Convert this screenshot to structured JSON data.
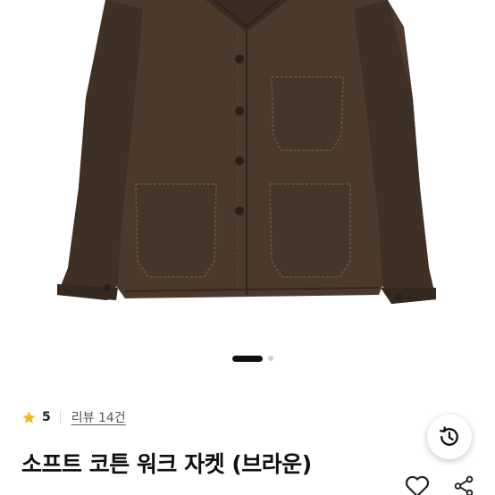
{
  "product": {
    "image_alt": "brown work jacket",
    "title": "소프트 코튼 워크 자켓 (브라운)"
  },
  "carousel": {
    "total_slides": 2,
    "active_index": 1
  },
  "rating": {
    "score": "5",
    "review_label": "리뷰 14건"
  },
  "actions": {
    "history_icon": "history-icon",
    "like_icon": "heart-icon",
    "share_icon": "share-icon"
  },
  "colors": {
    "star": "#f6b718",
    "jacket": "#4b3a2c",
    "text": "#111111"
  }
}
